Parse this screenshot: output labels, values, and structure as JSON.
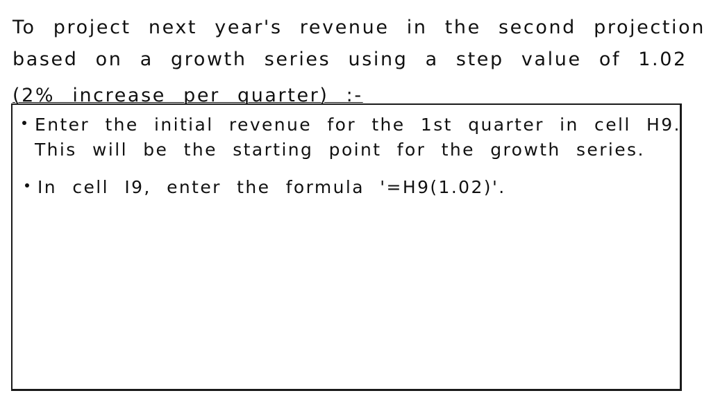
{
  "intro": {
    "line1": "To project next year's revenue in the second projection",
    "line2": "based on a growth series using a step value of 1.02",
    "line3": "(2% increase per quarter) :-"
  },
  "notes": {
    "bullets": [
      {
        "line1": "Enter the initial revenue for the 1st quarter in cell H9.",
        "line2": "This will be the starting point for the growth series."
      },
      {
        "line1": "In cell I9, enter the formula '=H9(1.02)'."
      }
    ]
  }
}
